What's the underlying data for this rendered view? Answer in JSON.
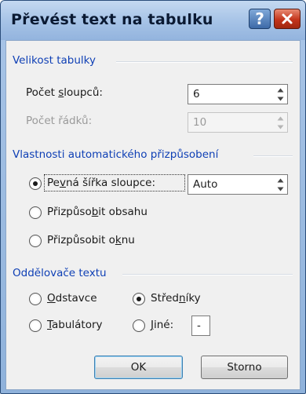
{
  "window": {
    "title": "Převést text na tabulku"
  },
  "titlebar": {
    "help_label": "?"
  },
  "table_size": {
    "group_label": "Velikost tabulky",
    "columns": {
      "label_pre": "Počet ",
      "label_u": "s",
      "label_post": "loupců:",
      "value": "6"
    },
    "rows": {
      "label": "Počet řádků:",
      "value": "10"
    }
  },
  "autofit": {
    "group_label": "Vlastnosti automatického přizpůsobení",
    "fixed": {
      "label_pre": "Pe",
      "label_u": "v",
      "label_post": "ná šířka sloupce:",
      "value": "Auto",
      "checked": true
    },
    "contents": {
      "label_pre": "Přizpůso",
      "label_u": "b",
      "label_post": "it obsahu",
      "checked": false
    },
    "window": {
      "label_pre": "Přizpůsobit o",
      "label_u": "k",
      "label_post": "nu",
      "checked": false
    }
  },
  "separators": {
    "group_label": "Oddělovače textu",
    "paragraphs": {
      "label_u": "O",
      "label_post": "dstavce",
      "checked": false
    },
    "semicolons": {
      "label_pre": "Střed",
      "label_u": "n",
      "label_post": "íky",
      "checked": true
    },
    "tabs": {
      "label_u": "T",
      "label_post": "abulátory",
      "checked": false
    },
    "other": {
      "label_u": "J",
      "label_post": "iné:",
      "checked": false,
      "value": "-"
    }
  },
  "buttons": {
    "ok": "OK",
    "cancel": "Storno"
  }
}
